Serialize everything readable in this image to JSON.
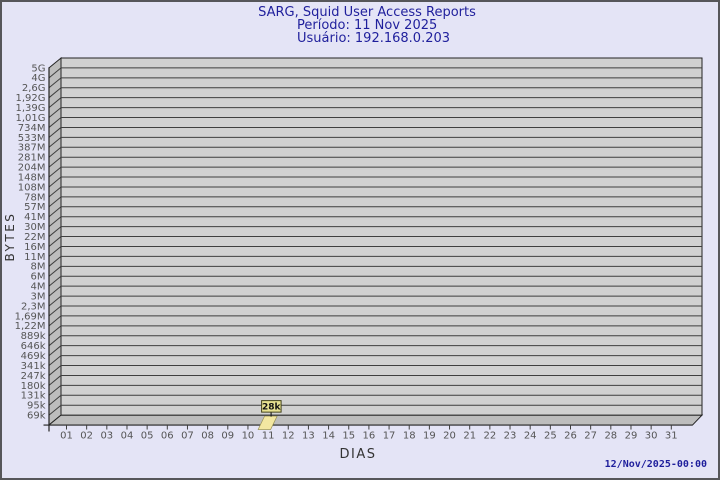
{
  "header": {
    "title": "SARG, Squid User Access Reports",
    "period": "Período: 11 Nov 2025",
    "user": "Usuário: 192.168.0.203"
  },
  "footer": {
    "timestamp": "12/Nov/2025-00:00"
  },
  "chart_data": {
    "type": "bar",
    "title": "SARG, Squid User Access Reports",
    "subtitle_period": "Período: 11 Nov 2025",
    "subtitle_user": "Usuário: 192.168.0.203",
    "xlabel": "DIAS",
    "ylabel": "BYTES",
    "y_scale": "log",
    "grid": "horizontal",
    "y_ticks": [
      "5G",
      "4G",
      "2,6G",
      "1,92G",
      "1,39G",
      "1,01G",
      "734M",
      "533M",
      "387M",
      "281M",
      "204M",
      "148M",
      "108M",
      "78M",
      "57M",
      "41M",
      "30M",
      "22M",
      "16M",
      "11M",
      "8M",
      "6M",
      "4M",
      "3M",
      "2,3M",
      "1,69M",
      "1,22M",
      "889k",
      "646k",
      "469k",
      "341k",
      "247k",
      "180k",
      "131k",
      "95k",
      "69k"
    ],
    "x_ticks": [
      "01",
      "02",
      "03",
      "04",
      "05",
      "06",
      "07",
      "08",
      "09",
      "10",
      "11",
      "12",
      "13",
      "14",
      "15",
      "16",
      "17",
      "18",
      "19",
      "20",
      "21",
      "22",
      "23",
      "24",
      "25",
      "26",
      "27",
      "28",
      "29",
      "30",
      "31"
    ],
    "bars": [
      {
        "x": "11",
        "label": "28k",
        "value_bytes": 28000
      }
    ],
    "colors": {
      "background": "#e4e4f6",
      "plot_bg": "#d1d1d1",
      "wall": "#bdbdbd",
      "grid": "#3f3f3f",
      "frame": "#222222",
      "tick_text": "#555555",
      "axis_title_text": "#333333",
      "title_text": "#1f1f9c",
      "bar_fill": "#f3e7a1",
      "bar_edge": "#8f884a",
      "value_box_fill": "#e8e291",
      "value_box_edge": "#44431a",
      "value_text": "#111111"
    }
  }
}
